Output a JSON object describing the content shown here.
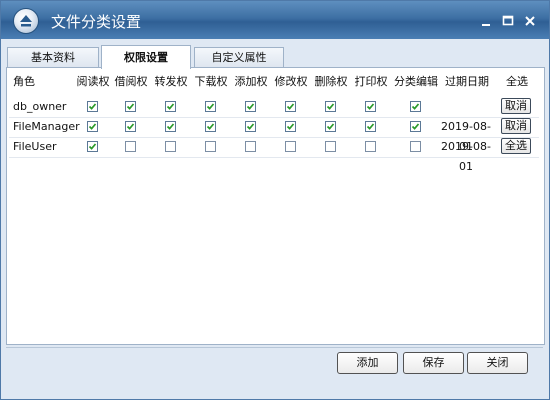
{
  "window": {
    "title": "文件分类设置"
  },
  "tabs": [
    {
      "label": "基本资料",
      "active": false
    },
    {
      "label": "权限设置",
      "active": true
    },
    {
      "label": "自定义属性",
      "active": false
    }
  ],
  "table": {
    "headers": [
      "角色",
      "阅读权",
      "借阅权",
      "转发权",
      "下载权",
      "添加权",
      "修改权",
      "删除权",
      "打印权",
      "分类编辑",
      "过期日期",
      "全选"
    ],
    "rows": [
      {
        "role": "db_owner",
        "perms": [
          true,
          true,
          true,
          true,
          true,
          true,
          true,
          true,
          true
        ],
        "expiry": "",
        "action": "取消"
      },
      {
        "role": "FileManager",
        "perms": [
          true,
          true,
          true,
          true,
          true,
          true,
          true,
          true,
          true
        ],
        "expiry": "2019-08-01",
        "action": "取消"
      },
      {
        "role": "FileUser",
        "perms": [
          true,
          false,
          false,
          false,
          false,
          false,
          false,
          false,
          false
        ],
        "expiry": "2019-08-01",
        "action": "全选"
      }
    ]
  },
  "footer": {
    "add": "添加",
    "save": "保存",
    "close": "关闭"
  },
  "colors": {
    "titlebar": "#3d6fa3",
    "checkmark": "#2a9a2a",
    "panel_border": "#9fb2c8"
  }
}
